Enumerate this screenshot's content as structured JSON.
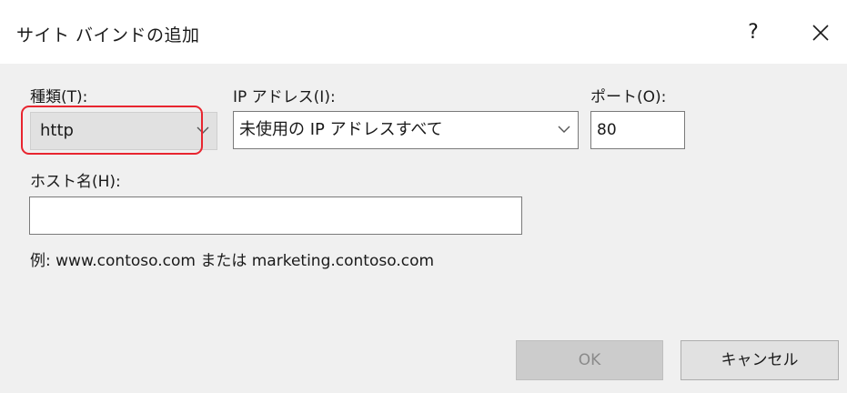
{
  "dialog": {
    "title": "サイト バインドの追加",
    "help_label": "?"
  },
  "form": {
    "type_label": "種類(T):",
    "type_value": "http",
    "ip_label": "IP アドレス(I):",
    "ip_value": "未使用の IP アドレスすべて",
    "port_label": "ポート(O):",
    "port_value": "80",
    "host_label": "ホスト名(H):",
    "host_value": "",
    "example_text": "例: www.contoso.com または marketing.contoso.com"
  },
  "buttons": {
    "ok_label": "OK",
    "cancel_label": "キャンセル"
  },
  "colors": {
    "highlight": "#e8252f",
    "dialog_bg": "#f0f0f0",
    "titlebar_bg": "#ffffff",
    "disabled_text": "#8a8a8a"
  },
  "icons": {
    "close": "close-icon",
    "dropdown": "chevron-down-icon"
  }
}
